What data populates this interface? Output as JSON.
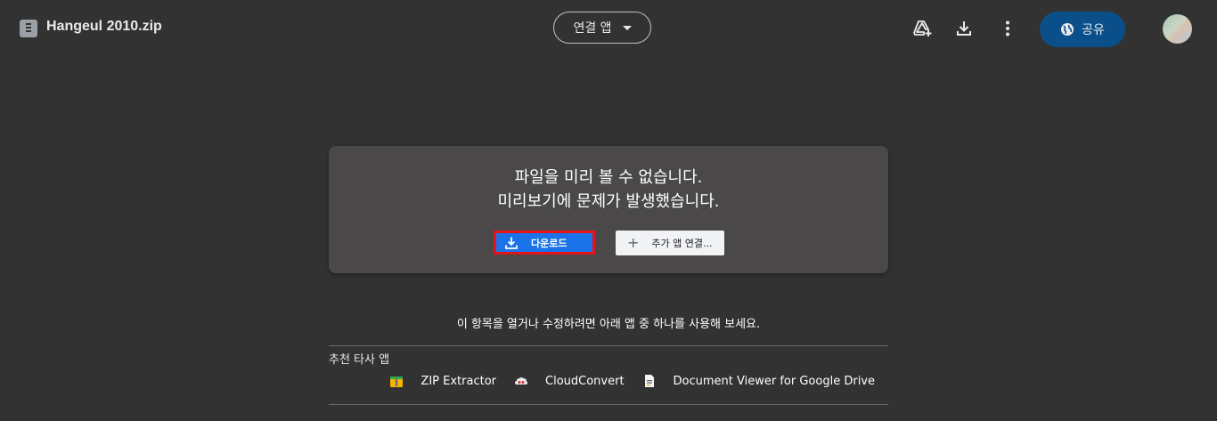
{
  "header": {
    "file_name": "Hangeul 2010.zip",
    "open_with_label": "연결 앱",
    "share_label": "공유"
  },
  "card": {
    "line1": "파일을 미리 볼 수 없습니다.",
    "line2": "미리보기에 문제가 발생했습니다.",
    "download_label": "다운로드",
    "add_app_label": "추가 앱 연결..."
  },
  "hint": "이 항목을 열거나 수정하려면 아래 앱 중 하나를 사용해 보세요.",
  "suggested": {
    "label": "추천 타사 앱",
    "apps": [
      {
        "name": "ZIP Extractor",
        "icon": "zip-extractor-icon"
      },
      {
        "name": "CloudConvert",
        "icon": "cloudconvert-icon"
      },
      {
        "name": "Document Viewer for Google Drive",
        "icon": "document-viewer-icon"
      }
    ]
  },
  "colors": {
    "background": "#323232",
    "share_button": "#0b4f8a",
    "download_button": "#1a73e8",
    "highlight_border": "#e3151a"
  },
  "icons": {
    "file": "file-icon",
    "add_shortcut": "add-to-drive-icon",
    "download": "download-icon",
    "more": "more-vert-icon",
    "share": "globe-icon"
  }
}
